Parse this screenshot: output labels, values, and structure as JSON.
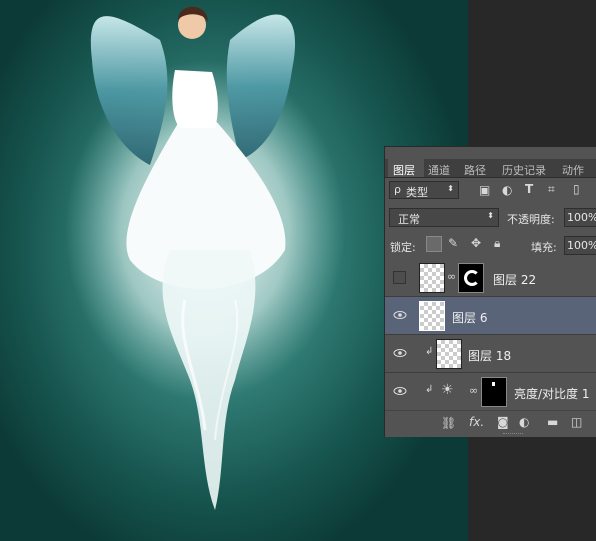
{
  "panel": {
    "tabs": [
      {
        "label": "图层",
        "active": true
      },
      {
        "label": "通道",
        "active": false
      },
      {
        "label": "路径",
        "active": false
      },
      {
        "label": "历史记录",
        "active": false
      },
      {
        "label": "动作",
        "active": false
      }
    ],
    "filter": {
      "label": "类型",
      "search_icon": "ρ"
    },
    "blend_mode": "正常",
    "opacity": {
      "label": "不透明度:",
      "value": "100%"
    },
    "lock": {
      "label": "锁定:"
    },
    "fill": {
      "label": "填充:",
      "value": "100%"
    },
    "layers": [
      {
        "name": "图层 22",
        "visible": false,
        "selected": false,
        "clipped": false,
        "has_mask": true
      },
      {
        "name": "图层 6",
        "visible": true,
        "selected": true,
        "clipped": false,
        "has_mask": false
      },
      {
        "name": "图层 18",
        "visible": true,
        "selected": false,
        "clipped": true,
        "has_mask": false
      },
      {
        "name": "亮度/对比度 1",
        "visible": true,
        "selected": false,
        "clipped": true,
        "has_mask": true,
        "adjustment": true
      }
    ],
    "footer_fx": "fx."
  },
  "colors": {
    "selected_row": "#5a6478",
    "panel_bg": "#535353",
    "canvas_teal": "#2f7a73"
  }
}
